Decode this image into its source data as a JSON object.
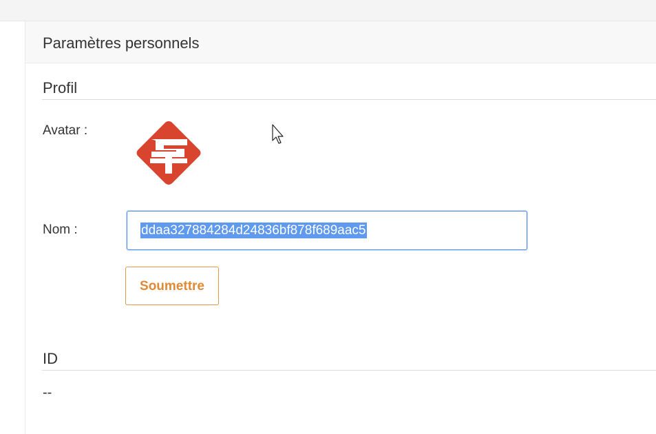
{
  "header": {
    "title": "Paramètres personnels"
  },
  "profile": {
    "section_title": "Profil",
    "avatar_label": "Avatar :",
    "avatar_icon": "st-logo-icon",
    "avatar_color": "#d9442e",
    "name_label": "Nom :",
    "name_value": "ddaa327884284d24836bf878f689aac5",
    "submit_label": "Soumettre"
  },
  "id_section": {
    "section_title": "ID",
    "value": "--"
  },
  "colors": {
    "accent_orange": "#e08a35",
    "input_focus_border": "#4a8cf0",
    "selection_bg": "#5f9aee"
  }
}
